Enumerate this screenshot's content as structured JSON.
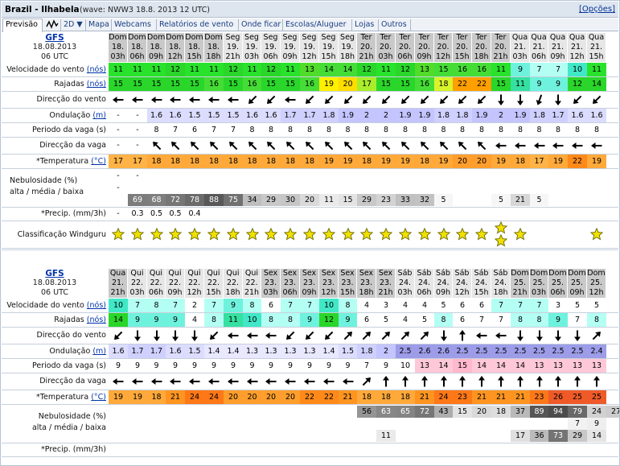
{
  "header": {
    "title": "Brazil - Ilhabela",
    "wave": "(wave: NWW3 18.8. 2013 12 UTC)",
    "options": "[Opções]"
  },
  "tabs": [
    {
      "label": "Previsão",
      "active": true
    },
    {
      "label": "icon",
      "icon": "wave-chart-icon"
    },
    {
      "label": "2D ▼"
    },
    {
      "label": "Mapa"
    },
    {
      "label": "Webcams"
    },
    {
      "label": "Relatórios de vento"
    },
    {
      "label": "Onde ficar"
    },
    {
      "label": "Escolas/Aluguer"
    },
    {
      "label": "Lojas"
    },
    {
      "label": "Outros"
    }
  ],
  "labels": {
    "wind": "Velocidade do vento",
    "wind_unit": "(nós)",
    "gusts": "Rajadas",
    "gusts_unit": "(nós)",
    "wind_dir": "Direcção do vento",
    "swell": "Ondulação",
    "swell_unit": "(m)",
    "period": "Periodo da vaga (s)",
    "wave_dir": "Direcção da vaga",
    "temp": "*Temperatura",
    "temp_unit": "(°C)",
    "cloud1": "Nebulosidade (%)",
    "cloud2": "alta / média / baixa",
    "precip": "*Precip. (mm/3h)",
    "rating": "Classificação Windguru"
  },
  "model": {
    "name": "GFS",
    "date": "18.08.2013",
    "utc": "06 UTC"
  },
  "colors": {
    "header_dark": "#a9aaa9",
    "header_light": "#d9d9d9",
    "wind_green": "#29d629",
    "wind_lgreen": "#7cfc7c",
    "wind_cyan": "#8ff5e8",
    "wind_teal": "#40e8d0",
    "gust_yellow": "#fff000",
    "gust_orange": "#ff9a00",
    "swell": "#c8c8ff",
    "period_pink": "#ffc8d8",
    "temp_orange": "#ffb246",
    "temp_dark": "#ff7a20",
    "temp_red": "#f05a28",
    "star": "#f0e000",
    "cloud_dark": "#7a7a7a"
  },
  "blocks": [
    {
      "days": [
        "Dom",
        "Dom",
        "Dom",
        "Dom",
        "Dom",
        "Dom",
        "Seg",
        "Seg",
        "Seg",
        "Seg",
        "Seg",
        "Seg",
        "Seg",
        "Ter",
        "Ter",
        "Ter",
        "Ter",
        "Ter",
        "Ter",
        "Ter",
        "Ter",
        "Qua",
        "Qua",
        "Qua",
        "Qua",
        "Qua"
      ],
      "dates": [
        "18.",
        "18.",
        "18.",
        "18.",
        "18.",
        "18.",
        "19.",
        "19.",
        "19.",
        "19.",
        "19.",
        "19.",
        "19.",
        "20.",
        "20.",
        "20.",
        "20.",
        "20.",
        "20.",
        "20.",
        "20.",
        "21.",
        "21.",
        "21.",
        "21.",
        "21."
      ],
      "hours": [
        "03h",
        "06h",
        "09h",
        "12h",
        "15h",
        "18h",
        "21h",
        "03h",
        "06h",
        "09h",
        "12h",
        "15h",
        "18h",
        "21h",
        "03h",
        "06h",
        "09h",
        "12h",
        "15h",
        "18h",
        "21h",
        "03h",
        "06h",
        "09h",
        "12h",
        "15h",
        "18h"
      ],
      "wind": [
        "11",
        "11",
        "11",
        "12",
        "11",
        "11",
        "12",
        "11",
        "12",
        "11",
        "13",
        "14",
        "14",
        "12",
        "11",
        "12",
        "13",
        "15",
        "16",
        "16",
        "11",
        "9",
        "7",
        "7",
        "10",
        "11"
      ],
      "gusts": [
        "15",
        "15",
        "15",
        "15",
        "15",
        "16",
        "15",
        "16",
        "15",
        "15",
        "16",
        "19",
        "20",
        "17",
        "15",
        "15",
        "16",
        "18",
        "22",
        "22",
        "15",
        "11",
        "9",
        "9",
        "12",
        "14"
      ],
      "wind_dir": [
        "W",
        "W",
        "W",
        "W",
        "W",
        "W",
        "W",
        "SW",
        "SW",
        "W",
        "SW",
        "SW",
        "SW",
        "SW",
        "SW",
        "SW",
        "SW",
        "SW",
        "SW",
        "SW",
        "S",
        "S",
        "SSW",
        "S",
        "SW",
        "SW"
      ],
      "swell": [
        "-",
        "-",
        "1.6",
        "1.6",
        "1.5",
        "1.5",
        "1.5",
        "1.6",
        "1.6",
        "1.7",
        "1.7",
        "1.8",
        "1.9",
        "2",
        "2",
        "1.9",
        "1.9",
        "1.8",
        "1.8",
        "1.9",
        "2",
        "1.9",
        "1.8",
        "1.7",
        "1.6",
        "1.6"
      ],
      "period": [
        "-",
        "-",
        "8",
        "7",
        "6",
        "7",
        "7",
        "8",
        "8",
        "8",
        "8",
        "8",
        "8",
        "8",
        "8",
        "8",
        "8",
        "8",
        "8",
        "8",
        "8",
        "8",
        "8",
        "8",
        "8",
        "8"
      ],
      "wave_dir": [
        "-",
        "-",
        "NW",
        "NW",
        "NW",
        "NW",
        "NW",
        "NW",
        "NW",
        "NW",
        "NW",
        "NW",
        "NW",
        "NW",
        "NW",
        "NW",
        "NW",
        "NW",
        "NW",
        "NW",
        "W",
        "W",
        "W",
        "W",
        "W",
        "W"
      ],
      "temp": [
        "17",
        "17",
        "18",
        "18",
        "18",
        "18",
        "18",
        "18",
        "18",
        "18",
        "18",
        "19",
        "19",
        "18",
        "19",
        "19",
        "18",
        "19",
        "20",
        "20",
        "19",
        "18",
        "17",
        "19",
        "22",
        "19"
      ],
      "cloud_high": [
        "-",
        "-",
        "",
        "",
        "",
        "",
        "",
        "",
        "",
        "",
        "",
        "",
        "",
        "",
        "",
        "",
        "",
        "",
        "",
        "",
        "",
        "",
        "",
        "",
        "",
        ""
      ],
      "cloud_mid": [
        "-",
        "",
        "",
        "",
        "",
        "",
        "",
        "",
        "",
        "",
        "",
        "",
        "",
        "",
        "",
        "",
        "",
        "",
        "",
        "",
        "",
        "",
        "",
        "",
        "",
        ""
      ],
      "cloud_low": [
        "",
        "69",
        "68",
        "72",
        "78",
        "88",
        "75",
        "34",
        "29",
        "30",
        "20",
        "11",
        "15",
        "29",
        "23",
        "33",
        "32",
        "5",
        "",
        "",
        "5",
        "21",
        "5",
        "",
        "",
        ""
      ],
      "precip": [
        "-",
        "0.3",
        "0.5",
        "0.5",
        "0.4",
        "",
        "",
        "",
        "",
        "",
        "",
        "",
        "",
        "",
        "",
        "",
        "",
        "",
        "",
        "",
        "",
        "",
        "",
        "",
        "",
        ""
      ],
      "stars": [
        1,
        1,
        1,
        1,
        1,
        1,
        1,
        1,
        1,
        1,
        1,
        1,
        1,
        1,
        1,
        1,
        1,
        1,
        1,
        1,
        2,
        1,
        0,
        0,
        0,
        1
      ]
    },
    {
      "days": [
        "Qua",
        "Qui",
        "Qui",
        "Qui",
        "Qui",
        "Qui",
        "Qui",
        "Qui",
        "Sex",
        "Sex",
        "Sex",
        "Sex",
        "Sex",
        "Sex",
        "Sex",
        "Sáb",
        "Sáb",
        "Sáb",
        "Sáb",
        "Sáb",
        "Sáb",
        "Dom",
        "Dom",
        "Dom",
        "Dom",
        "Dom"
      ],
      "dates": [
        "21.",
        "22.",
        "22.",
        "22.",
        "22.",
        "22.",
        "22.",
        "22.",
        "23.",
        "23.",
        "23.",
        "23.",
        "23.",
        "23.",
        "23.",
        "24.",
        "24.",
        "24.",
        "24.",
        "24.",
        "24.",
        "25.",
        "25.",
        "25.",
        "25.",
        "25."
      ],
      "hours": [
        "21h",
        "03h",
        "06h",
        "09h",
        "12h",
        "15h",
        "18h",
        "21h",
        "03h",
        "06h",
        "09h",
        "12h",
        "15h",
        "18h",
        "21h",
        "03h",
        "06h",
        "09h",
        "12h",
        "15h",
        "18h",
        "21h",
        "03h",
        "06h",
        "09h",
        "12h",
        "15h"
      ],
      "wind": [
        "10",
        "7",
        "8",
        "7",
        "2",
        "7",
        "9",
        "8",
        "6",
        "7",
        "7",
        "10",
        "8",
        "4",
        "3",
        "4",
        "4",
        "5",
        "6",
        "6",
        "7",
        "7",
        "7",
        "3",
        "5",
        "5"
      ],
      "gusts": [
        "14",
        "9",
        "9",
        "9",
        "4",
        "8",
        "11",
        "10",
        "8",
        "8",
        "9",
        "12",
        "9",
        "6",
        "5",
        "4",
        "5",
        "8",
        "6",
        "7",
        "7",
        "8",
        "8",
        "9",
        "7",
        "8"
      ],
      "wind_dir": [
        "SW",
        "S",
        "S",
        "S",
        "S",
        "SW",
        "W",
        "W",
        "W",
        "SW",
        "SW",
        "SW",
        "NE",
        "NE",
        "NE",
        "NE",
        "NE",
        "S",
        "N",
        "W",
        "W",
        "S",
        "S",
        "S",
        "S",
        "NE"
      ],
      "swell": [
        "1.6",
        "1.7",
        "1.7",
        "1.6",
        "1.5",
        "1.4",
        "1.4",
        "1.3",
        "1.3",
        "1.3",
        "1.3",
        "1.4",
        "1.5",
        "1.8",
        "2",
        "2.5",
        "2.6",
        "2.6",
        "2.5",
        "2.5",
        "2.5",
        "2.5",
        "2.5",
        "2.5",
        "2.5",
        "2.4"
      ],
      "period": [
        "9",
        "9",
        "9",
        "9",
        "9",
        "9",
        "9",
        "9",
        "9",
        "9",
        "9",
        "9",
        "9",
        "7",
        "9",
        "10",
        "13",
        "14",
        "15",
        "14",
        "14",
        "14",
        "13",
        "13",
        "13",
        "13"
      ],
      "wave_dir": [
        "W",
        "W",
        "W",
        "W",
        "W",
        "W",
        "W",
        "W",
        "W",
        "W",
        "W",
        "W",
        "W",
        "NE",
        "N",
        "N",
        "N",
        "N",
        "N",
        "N",
        "N",
        "N",
        "N",
        "N",
        "N",
        "N"
      ],
      "temp": [
        "19",
        "19",
        "18",
        "21",
        "24",
        "24",
        "20",
        "20",
        "20",
        "20",
        "22",
        "22",
        "21",
        "18",
        "18",
        "18",
        "21",
        "24",
        "23",
        "21",
        "21",
        "21",
        "23",
        "26",
        "25",
        "25"
      ],
      "cloud_high": [
        "",
        "",
        "",
        "",
        "",
        "",
        "",
        "",
        "",
        "",
        "",
        "",
        "",
        "56",
        "63",
        "65",
        "72",
        "43",
        "15",
        "20",
        "18",
        "37",
        "89",
        "94",
        "79",
        "24",
        "27"
      ],
      "cloud_mid": [
        "",
        "",
        "",
        "",
        "",
        "",
        "",
        "",
        "",
        "",
        "",
        "",
        "",
        "",
        "",
        "",
        "",
        "",
        "",
        "",
        "",
        "",
        "",
        "",
        "7",
        "9"
      ],
      "cloud_low": [
        "",
        "",
        "",
        "",
        "",
        "",
        "",
        "",
        "",
        "",
        "",
        "",
        "",
        "",
        "11",
        "",
        "",
        "",
        "",
        "",
        "",
        "17",
        "36",
        "73",
        "29",
        "14"
      ],
      "precip": [
        "",
        "",
        "",
        "",
        "",
        "",
        "",
        "",
        "",
        "",
        "",
        "",
        "",
        "",
        "",
        "",
        "",
        "",
        "",
        "",
        "",
        "",
        "",
        "",
        "",
        ""
      ],
      "stars": []
    }
  ]
}
